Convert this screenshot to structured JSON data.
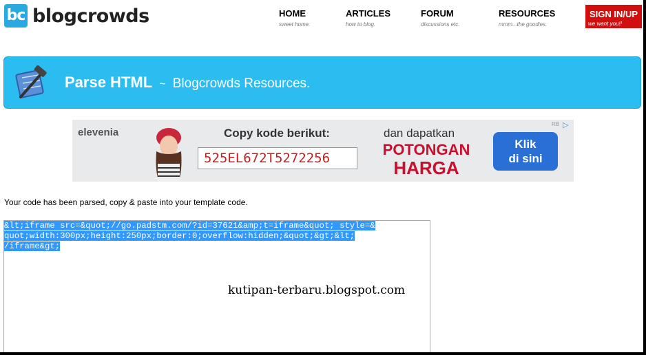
{
  "header": {
    "logo_badge": "bc",
    "logo_text": "blogcrowds",
    "nav": [
      {
        "label": "HOME",
        "sub": "sweet home."
      },
      {
        "label": "ARTICLES",
        "sub": "how to blog."
      },
      {
        "label": "FORUM",
        "sub": "discussions etc."
      },
      {
        "label": "RESOURCES",
        "sub": "mmm...the goodies."
      }
    ],
    "signin": {
      "label": "SIGN IN/UP",
      "sub": "we want you!!"
    }
  },
  "banner": {
    "title": "Parse HTML",
    "separator": "~",
    "subtitle": "Blogcrowds Resources."
  },
  "ad": {
    "brand": "elevenia",
    "copy_text": "Copy kode berikut:",
    "code": "525EL672T5272256",
    "promo_line1": "dan dapatkan",
    "promo_line2": "POTONGAN",
    "promo_line3": "HARGA",
    "cta_line1": "Klik",
    "cta_line2": "di sini",
    "adchoices": "RB"
  },
  "message": "Your code has been parsed, copy & paste into your template code.",
  "parsed_code_lines": [
    "&lt;iframe src=&quot;//go.padstm.com/?id=37621&amp;t=iframe&quot; style=&",
    "quot;width:300px;height:250px;border:0;overflow:hidden;&quot;&gt;&lt;",
    "/iframe&gt;"
  ],
  "watermark": "kutipan-terbaru.blogspot.com",
  "colors": {
    "brand_blue": "#2aa9e0",
    "banner_blue": "#2bbdf0",
    "signin_red": "#d20f0f",
    "selection_blue": "#3298fd"
  }
}
